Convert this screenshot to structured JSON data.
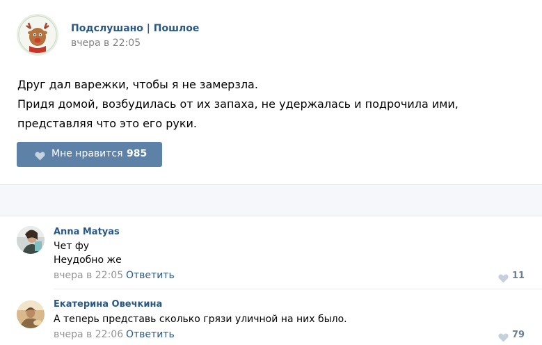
{
  "post": {
    "author": "Подслушано | Пошлое",
    "time": "вчера в 22:05",
    "text_lines": [
      "Друг дал варежки, чтобы я не замерзла.",
      "Придя домой, возбудилась от их запаха, не удержалась и подрочила ими,",
      "представляя что это его руки."
    ],
    "like_label": "Мне нравится",
    "like_count": "985"
  },
  "comments": [
    {
      "author": "Anna Matyas",
      "lines": [
        "Чет фу",
        "Неудобно же"
      ],
      "time": "вчера в 22:05",
      "reply_label": "Ответить",
      "likes": "11"
    },
    {
      "author": "Екатерина Овечкина",
      "lines": [
        "А теперь представь сколько грязи уличной на них было."
      ],
      "time": "вчера в 22:06",
      "reply_label": "Ответить",
      "likes": "79"
    }
  ],
  "colors": {
    "link": "#2a5885",
    "like_button": "#5e81a8",
    "muted": "#828282"
  }
}
